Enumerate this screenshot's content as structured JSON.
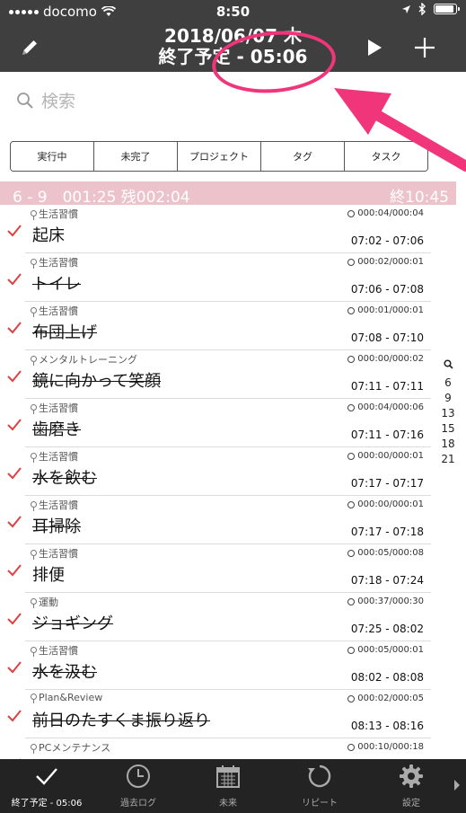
{
  "status_bar": {
    "carrier": "docomo",
    "time": "8:50"
  },
  "nav": {
    "title_line1": "2018/06/07 木",
    "title_line2": "終了予定 - 05:06"
  },
  "search": {
    "placeholder": "検索"
  },
  "filters": [
    "実行中",
    "未完了",
    "プロジェクト",
    "タグ",
    "タスク"
  ],
  "section": {
    "left": "6 - 9　001:25 残002:04",
    "right": "終10:45"
  },
  "tasks": [
    {
      "project": "生活習慣",
      "duration": "000:04/000:04",
      "title": "起床",
      "time": "07:02 - 07:06",
      "struck": false
    },
    {
      "project": "生活習慣",
      "duration": "000:02/000:01",
      "title": "トイレ",
      "time": "07:06 - 07:08",
      "struck": true
    },
    {
      "project": "生活習慣",
      "duration": "000:01/000:01",
      "title": "布団上げ",
      "time": "07:08 - 07:10",
      "struck": true
    },
    {
      "project": "メンタルトレーニング",
      "duration": "000:00/000:02",
      "title": "鏡に向かって笑顔",
      "time": "07:11 - 07:11",
      "struck": true
    },
    {
      "project": "生活習慣",
      "duration": "000:04/000:06",
      "title": "歯磨き",
      "time": "07:11 - 07:16",
      "struck": true
    },
    {
      "project": "生活習慣",
      "duration": "000:00/000:01",
      "title": "水を飲む",
      "time": "07:17 - 07:17",
      "struck": true
    },
    {
      "project": "生活習慣",
      "duration": "000:00/000:01",
      "title": "耳掃除",
      "time": "07:17 - 07:18",
      "struck": true
    },
    {
      "project": "生活習慣",
      "duration": "000:05/000:08",
      "title": "排便",
      "time": "07:18 - 07:24",
      "struck": false
    },
    {
      "project": "運動",
      "duration": "000:37/000:30",
      "title": "ジョギング",
      "time": "07:25 - 08:02",
      "struck": true
    },
    {
      "project": "生活習慣",
      "duration": "000:05/000:01",
      "title": "水を汲む",
      "time": "08:02 - 08:08",
      "struck": true
    },
    {
      "project": "Plan&Review",
      "duration": "000:02/000:05",
      "title": "前日のたすくま振り返り",
      "time": "08:13 - 08:16",
      "struck": true
    },
    {
      "project": "PCメンテナンス",
      "duration": "000:10/000:18",
      "title": "",
      "time": "",
      "struck": false
    }
  ],
  "index_items": [
    "6",
    "9",
    "13",
    "15",
    "18",
    "21"
  ],
  "tabs": [
    {
      "label": "終了予定 - 05:06",
      "icon": "checkmark-icon",
      "active": true
    },
    {
      "label": "過去ログ",
      "icon": "clock-icon",
      "active": false
    },
    {
      "label": "未来",
      "icon": "calendar-icon",
      "active": false
    },
    {
      "label": "リピート",
      "icon": "repeat-icon",
      "active": false
    },
    {
      "label": "設定",
      "icon": "gear-icon",
      "active": false
    }
  ],
  "colors": {
    "bar": "#3f3f3f",
    "section": "#edc3cb",
    "check": "#e04040",
    "annotation": "#f0357a",
    "tabbar": "#232323"
  }
}
